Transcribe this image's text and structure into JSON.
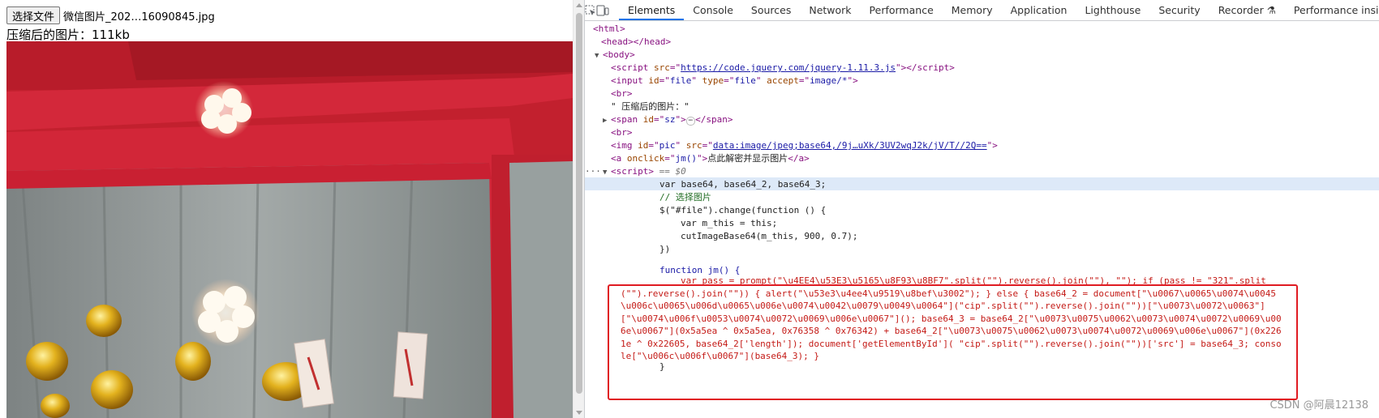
{
  "page": {
    "choose_file_label": "选择文件",
    "file_name": "微信图片_202…16090845.jpg",
    "size_label": "压缩后的图片：",
    "size_value": "111kb"
  },
  "devtools": {
    "tabs": [
      "Elements",
      "Console",
      "Sources",
      "Network",
      "Performance",
      "Memory",
      "Application",
      "Lighthouse",
      "Security",
      "Recorder",
      "Performance insights"
    ],
    "active_tab": "Elements",
    "tree": {
      "html_open": "<html>",
      "head": "<head></head>",
      "body_open": "<body>",
      "script_src_attr": "src",
      "script_src_val": "https://code.jquery.com/jquery-1.11.3.js",
      "input_id": "file",
      "input_type": "file",
      "input_accept": "image/*",
      "br": "<br>",
      "text_node": "\" 压缩后的图片：\"",
      "span_id": "sz",
      "img_id": "pic",
      "img_src": "data:image/jpeg;base64,/9j…uXk/3UV2wqJ2k/jV/T//2Q==",
      "a_onclick": "jm()",
      "a_text": "点此解密并显示图片",
      "script_eq": "== $0",
      "js_line1": "var base64, base64_2, base64_3;",
      "js_comment": "// 选择图片",
      "js_change": "$(\"#file\").change(function () {",
      "js_mthis": "var m_this = this;",
      "js_cut": "cutImageBase64(m_this, 900, 0.7);",
      "js_close": "})",
      "fn_decl": "function jm() {",
      "fn_body": "var pass = prompt(\"\\u4EE4\\u53E3\\u5165\\u8F93\\u8BF7\".split(\"\").reverse().join(\"\"), \"\"); if (pass != \"321\".split(\"\").reverse().join(\"\")) { alert(\"\\u53e3\\u4ee4\\u9519\\u8bef\\u3002\"); } else { base64_2 = document[\"\\u0067\\u0065\\u0074\\u0045\\u006c\\u0065\\u006d\\u0065\\u006e\\u0074\\u0042\\u0079\\u0049\\u0064\"](\"cip\".split(\"\").reverse().join(\"\"))[\"\\u0073\\u0072\\u0063\"][\"\\u0074\\u006f\\u0053\\u0074\\u0072\\u0069\\u006e\\u0067\"](); base64_3 = base64_2[\"\\u0073\\u0075\\u0062\\u0073\\u0074\\u0072\\u0069\\u006e\\u0067\"](0x5a5ea ^ 0x5a5ea, 0x76358 ^ 0x76342) + base64_2[\"\\u0073\\u0075\\u0062\\u0073\\u0074\\u0072\\u0069\\u006e\\u0067\"](0x2261e ^ 0x22605, base64_2['length']); document['getElementById']( \"cip\".split(\"\").reverse().join(\"\"))['src'] = base64_3; console[\"\\u006c\\u006f\\u0067\"](base64_3); }",
      "fn_close": "}"
    }
  },
  "watermark": "CSDN @阿晨12138",
  "colors": {
    "highlight_border": "#e01b22",
    "tab_accent": "#1a73e8",
    "selected_row": "#dde9f8"
  }
}
